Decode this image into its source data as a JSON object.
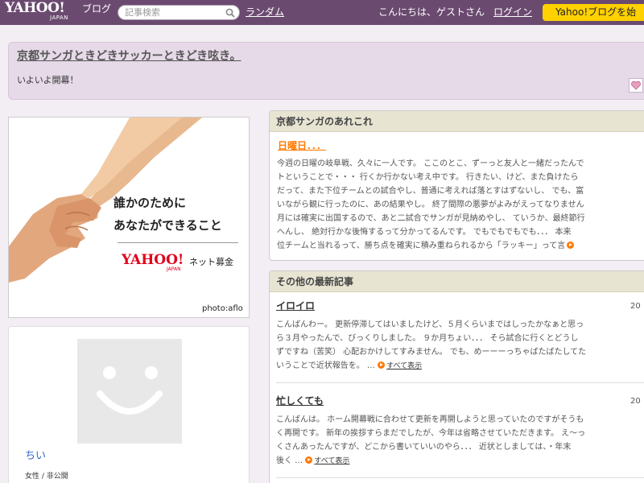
{
  "topbar": {
    "logo_main": "YAHOO!",
    "logo_sub": "JAPAN",
    "logo_service": "ブログ",
    "search_placeholder": "記事検索",
    "random_link": "ランダム",
    "greeting": "こんにちは、ゲストさん",
    "login_link": "ログイン",
    "cta_label": "Yahoo!ブログを始"
  },
  "header": {
    "title": "京都サンガときどきサッカーときどき呟き。",
    "subtitle": "いよいよ開幕！"
  },
  "ad": {
    "line1": "誰かのために",
    "line2": "あなたができること",
    "brand_main": "YAHOO!",
    "brand_sub": "JAPAN",
    "service": "ネット募金",
    "credit": "photo:aflo"
  },
  "profile": {
    "nickname": "ちい",
    "meta": "女性 / 非公開"
  },
  "featured": {
    "heading": "京都サンガのあれこれ",
    "title": "日曜日．．．",
    "lines": [
      "今週の日曜の岐阜戦、久々に一人です。 ここのとこ、ずーっと友人と一緒だったんで",
      "トということで・・・ 行くか行かない考え中です。 行きたい、けど、また負けたら",
      "だって、また下位チームとの試合やし、普通に考えれば落とすはずないし、 でも、富",
      "いながら観に行ったのに、あの結果やし。 終了間際の悪夢がよみがえってなりません",
      "月には確実に出国するので、あと二試合でサンガが見納めやし、 ていうか、最終節行",
      "へんし、 絶対行かな後悔するって分かってるんです。 でもでもでもでも．．． 本来",
      "位チームと当れるって、勝ち点を確実に積み重ねられるから「ラッキー」って言"
    ]
  },
  "recent": {
    "heading": "その他の最新記事",
    "more_label": "すべて表示",
    "entries": [
      {
        "title": "イロイロ",
        "date": "20",
        "lines": [
          "こんばんわー。 更新停滞してはいましたけど、５月くらいまではしったかなぁと思っ",
          "ら３月やったんで、びっくりしました。 ９か月ちょい．．． そら試合に行くとどうし",
          "ずですね（苦笑） 心配おかけしてすみません。 でも、めーーーっちゃばたばたしてた",
          "いうことで近状報告を。 …"
        ]
      },
      {
        "title": "忙しくても",
        "date": "20",
        "lines": [
          "こんばんは。 ホーム開幕戦に合わせて更新を再開しようと思っていたのですがそうも",
          "く再開です。 新年の挨拶すらまだでしたが、今年は省略させていただきます。 え～っ",
          "くさんあったんですが、どこから書いていいのやら．．． 近状としましては、・年末",
          "後く …"
        ]
      }
    ]
  },
  "colors": {
    "topbar": "#6b4a70",
    "header_bg": "#e6d9e8",
    "accent": "#ff7a00",
    "cta": "#ffd100",
    "brand_red": "#e0001b",
    "link_blue": "#3366cc"
  }
}
